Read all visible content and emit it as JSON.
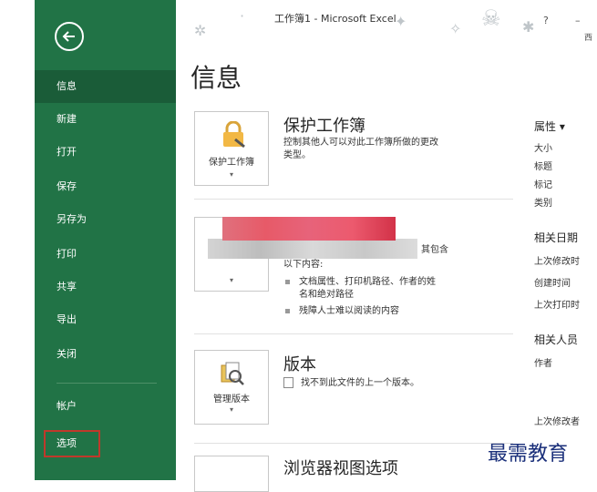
{
  "window": {
    "title": "工作簿1 - Microsoft Excel",
    "help": "?",
    "min": "–",
    "account_short": "西"
  },
  "sidebar": {
    "items": [
      {
        "label": "信息",
        "active": true
      },
      {
        "label": "新建"
      },
      {
        "label": "打开"
      },
      {
        "label": "保存"
      },
      {
        "label": "另存为"
      },
      {
        "label": "打印"
      },
      {
        "label": "共享"
      },
      {
        "label": "导出"
      },
      {
        "label": "关闭"
      }
    ],
    "account": "帐户",
    "options": "选项"
  },
  "page": {
    "title": "信息"
  },
  "protect": {
    "button_label": "保护工作簿",
    "title": "保护工作簿",
    "desc_line1": "控制其他人可以对此工作簿所做的更改",
    "desc_line2": "类型。"
  },
  "inspect": {
    "desc_tail": "其包含",
    "desc_line2": "以下内容:",
    "bullet1_line1": "文档属性、打印机路径、作者的姓",
    "bullet1_line2": "名和绝对路径",
    "bullet2": "残障人士难以阅读的内容"
  },
  "versions": {
    "button_label": "管理版本",
    "title": "版本",
    "desc": "找不到此文件的上一个版本。"
  },
  "browser": {
    "title": "浏览器视图选项"
  },
  "properties": {
    "heading": "属性 ▾",
    "items": [
      "大小",
      "标题",
      "标记",
      "类别"
    ],
    "dates_heading": "相关日期",
    "dates": [
      "上次修改时",
      "创建时间",
      "上次打印时"
    ],
    "people_heading": "相关人员",
    "people": [
      "作者"
    ],
    "last_modified_by": "上次修改者"
  },
  "watermark": "最需教育"
}
